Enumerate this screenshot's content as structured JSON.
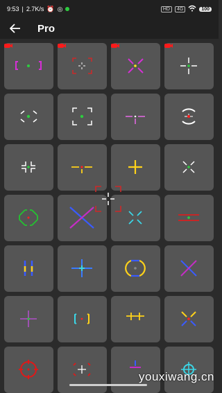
{
  "status_bar": {
    "time": "9:53",
    "net_speed": "2.7K/s",
    "right_badges": [
      "HD",
      "4G"
    ],
    "battery": "100"
  },
  "header": {
    "title": "Pro"
  },
  "tiles_count": 28,
  "locked_count": 4,
  "watermark": "youxiwang.cn"
}
